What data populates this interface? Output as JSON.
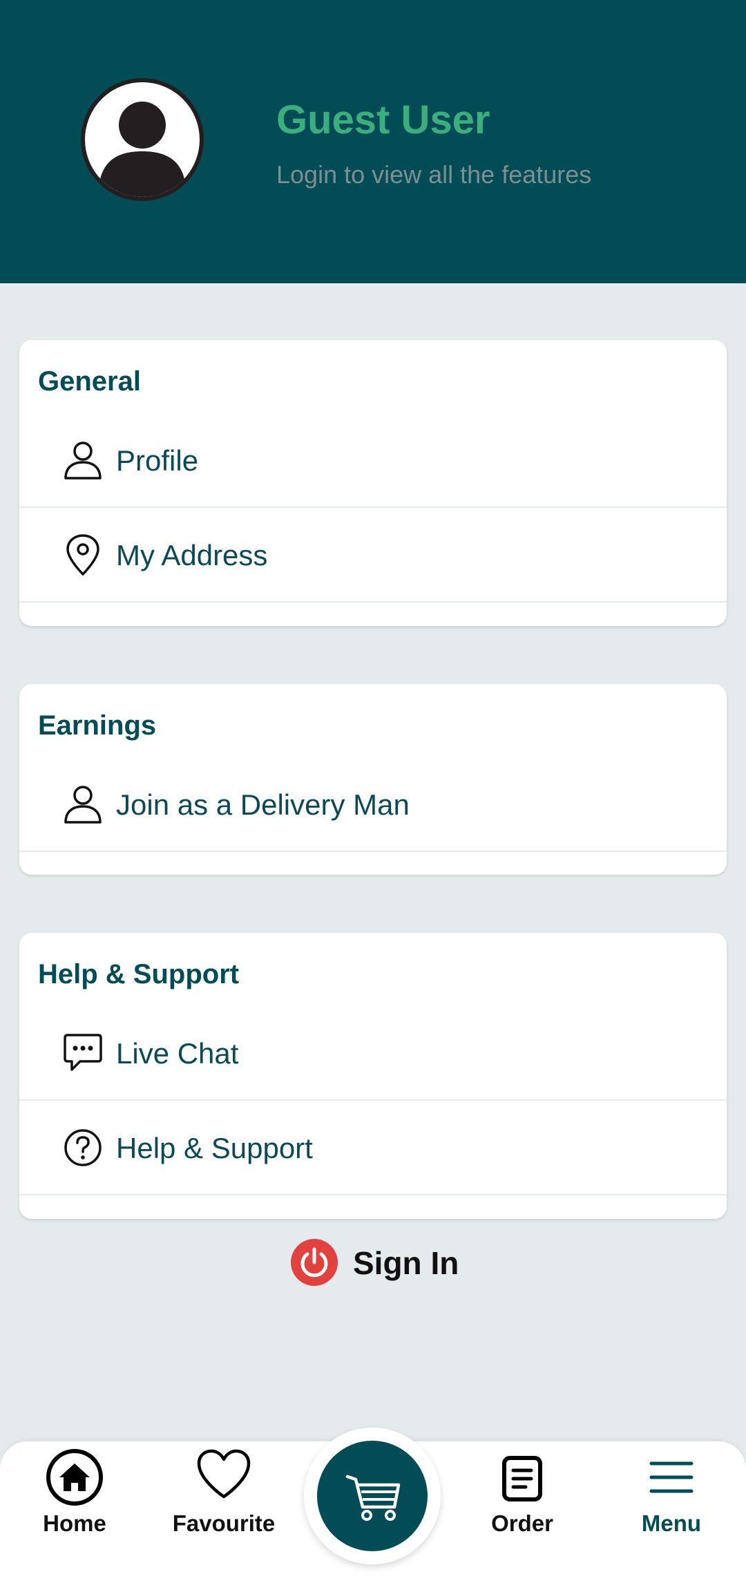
{
  "header": {
    "name": "Guest User",
    "subtitle": "Login to view all the features"
  },
  "sections": {
    "general": {
      "title": "General",
      "items": [
        {
          "label": "Profile",
          "icon": "person-icon"
        },
        {
          "label": "My Address",
          "icon": "location-pin-icon"
        }
      ]
    },
    "earnings": {
      "title": "Earnings",
      "items": [
        {
          "label": "Join as a Delivery Man",
          "icon": "person-icon"
        }
      ]
    },
    "help": {
      "title": "Help & Support",
      "items": [
        {
          "label": "Live Chat",
          "icon": "chat-icon"
        },
        {
          "label": "Help & Support",
          "icon": "question-icon"
        }
      ]
    }
  },
  "signin": {
    "label": "Sign In",
    "icon": "power-icon"
  },
  "bottom_nav": {
    "home": "Home",
    "favourite": "Favourite",
    "order": "Order",
    "menu": "Menu",
    "cart_icon": "cart-icon"
  },
  "colors": {
    "header_bg": "#024d55",
    "accent_green": "#3cae7e",
    "power_red": "#e2423e",
    "page_bg": "#e5ebec"
  }
}
